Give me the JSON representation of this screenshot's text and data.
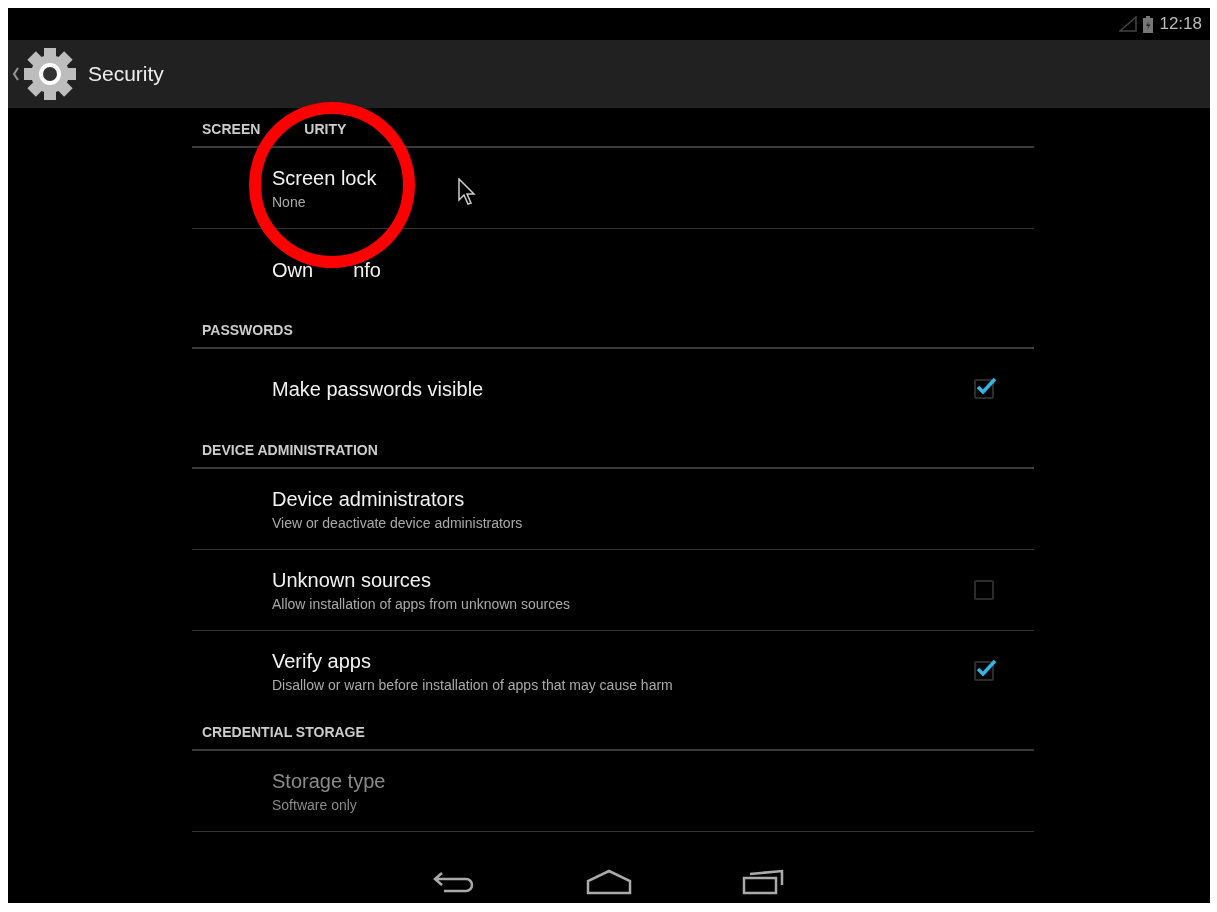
{
  "status_bar": {
    "time": "12:18"
  },
  "action_bar": {
    "title": "Security"
  },
  "sections": [
    {
      "header_parts": [
        "SCREEN",
        "URITY"
      ],
      "items": [
        {
          "kind": "plain",
          "title": "Screen lock",
          "summary": "None",
          "disabled": false
        },
        {
          "kind": "plain",
          "title_parts": [
            "Own",
            "nfo"
          ],
          "disabled": false
        }
      ]
    },
    {
      "header": "PASSWORDS",
      "items": [
        {
          "kind": "checkbox",
          "title": "Make passwords visible",
          "checked": true,
          "disabled": false
        }
      ]
    },
    {
      "header": "DEVICE ADMINISTRATION",
      "items": [
        {
          "kind": "plain",
          "title": "Device administrators",
          "summary": "View or deactivate device administrators",
          "disabled": false
        },
        {
          "kind": "checkbox",
          "title": "Unknown sources",
          "summary": "Allow installation of apps from unknown sources",
          "checked": false,
          "disabled": false
        },
        {
          "kind": "checkbox",
          "title": "Verify apps",
          "summary": "Disallow or warn before installation of apps that may cause harm",
          "checked": true,
          "disabled": false
        }
      ]
    },
    {
      "header": "CREDENTIAL STORAGE",
      "items": [
        {
          "kind": "plain",
          "title": "Storage type",
          "summary": "Software only",
          "disabled": true
        }
      ]
    }
  ]
}
